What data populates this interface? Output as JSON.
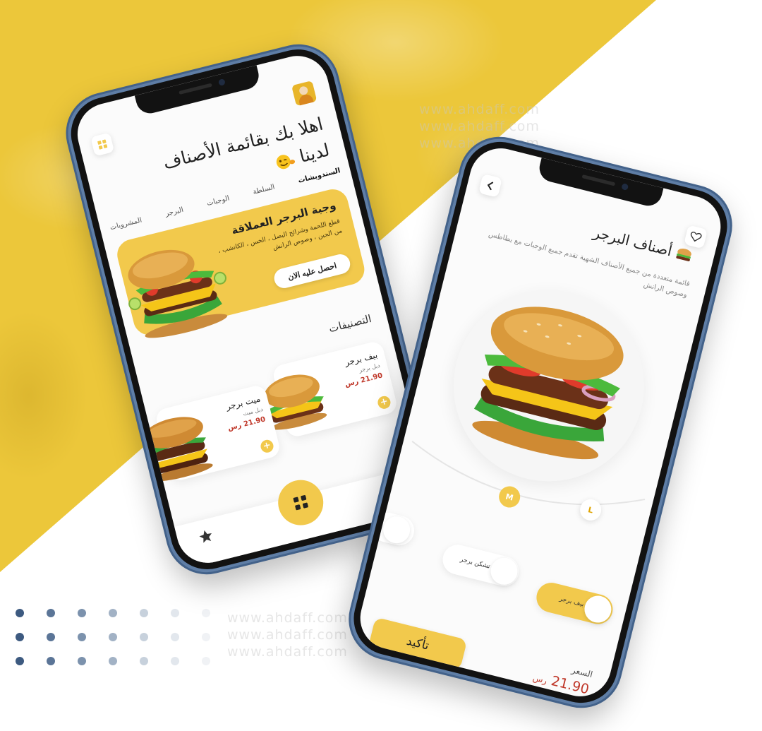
{
  "watermark": "www.ahdaff.com",
  "colors": {
    "accent": "#f2c94c",
    "price": "#c0392b",
    "background_yellow": "#ecc73a"
  },
  "home": {
    "menu_icon": "grid-icon",
    "avatar": "avatar-chef",
    "greeting": "اهلا بك بقائمة الأصناف لدينا",
    "greeting_emoji": "wink-emoji-icon",
    "tabs": [
      "السندويشات",
      "السلطة",
      "الوجبات",
      "البرجر",
      "المشروبات"
    ],
    "promo": {
      "title": "وجبة البرجر العملاقة",
      "description": "قطع اللحمة وشرائح البصل ، الخس ، الكاتشب ، من الجبن ، وصوص الرانش",
      "button": "احصل عليه الان"
    },
    "section_title": "التصنيفات",
    "cards": [
      {
        "name": "بيف برجر",
        "sub": "دبل برجر",
        "price": "21.90",
        "currency": "رس"
      },
      {
        "name": "ميت برجر",
        "sub": "دبل ميت",
        "price": "21.90",
        "currency": "رس"
      }
    ],
    "nav": {
      "home": "home-icon",
      "center": "grid-icon",
      "favorites": "star-icon"
    }
  },
  "detail": {
    "back": "chevron-left-icon",
    "favorite": "heart-icon",
    "title": "أصناف البرجر",
    "description": "قائمة متعددة من جميع الأصناف الشهية تقدم جميع الوجبات مع بطاطس وصوص الرانش",
    "sizes": [
      "M",
      "L"
    ],
    "selected_size": "M",
    "chips": [
      {
        "label": "بيف برجر",
        "active": true
      },
      {
        "label": "تشكن برجر",
        "active": false
      }
    ],
    "confirm": "تأكيد",
    "price_label": "السعر",
    "price": "21.90",
    "currency": "رس"
  }
}
